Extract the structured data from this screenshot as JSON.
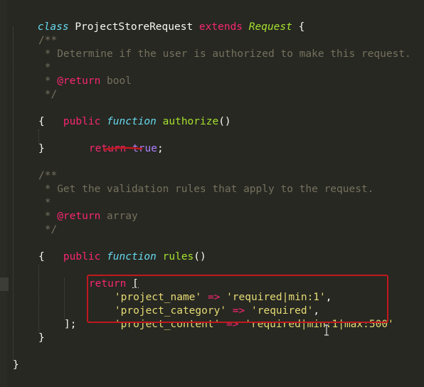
{
  "code": {
    "class_keyword": "class",
    "class_name": "ProjectStoreRequest",
    "extends_keyword": "extends",
    "parent_class": "Request",
    "open_brace": "{",
    "close_brace": "}",
    "doc1": {
      "open": "/**",
      "desc": " * Determine if the user is authorized to make this request.",
      "blank": " *",
      "return_prefix": " * ",
      "return_tag": "@return",
      "return_type": " bool",
      "close": " */"
    },
    "method1": {
      "public": "public",
      "function": "function",
      "name": "authorize",
      "parens": "()",
      "open": "{",
      "return": "return",
      "value": "true",
      "semicolon": ";",
      "close": "}"
    },
    "doc2": {
      "open": "/**",
      "desc": " * Get the validation rules that apply to the request.",
      "blank": " *",
      "return_prefix": " * ",
      "return_tag": "@return",
      "return_type": " array",
      "close": " */"
    },
    "method2": {
      "public": "public",
      "function": "function",
      "name": "rules",
      "parens": "()",
      "open": "{",
      "return": "return",
      "array_open": "[",
      "rules": [
        {
          "key": "'project_name'",
          "arrow": "=>",
          "value": "'required|min:1'",
          "sep": ","
        },
        {
          "key": "'project_category'",
          "arrow": "=>",
          "value": "'required'",
          "sep": ","
        },
        {
          "key": "'project_content'",
          "arrow": "=>",
          "value": "'required|min:1|max:500'",
          "sep": ""
        }
      ],
      "array_close": "];",
      "close": "}"
    }
  },
  "colors": {
    "background": "#272822",
    "annotation": "#c0181e"
  }
}
